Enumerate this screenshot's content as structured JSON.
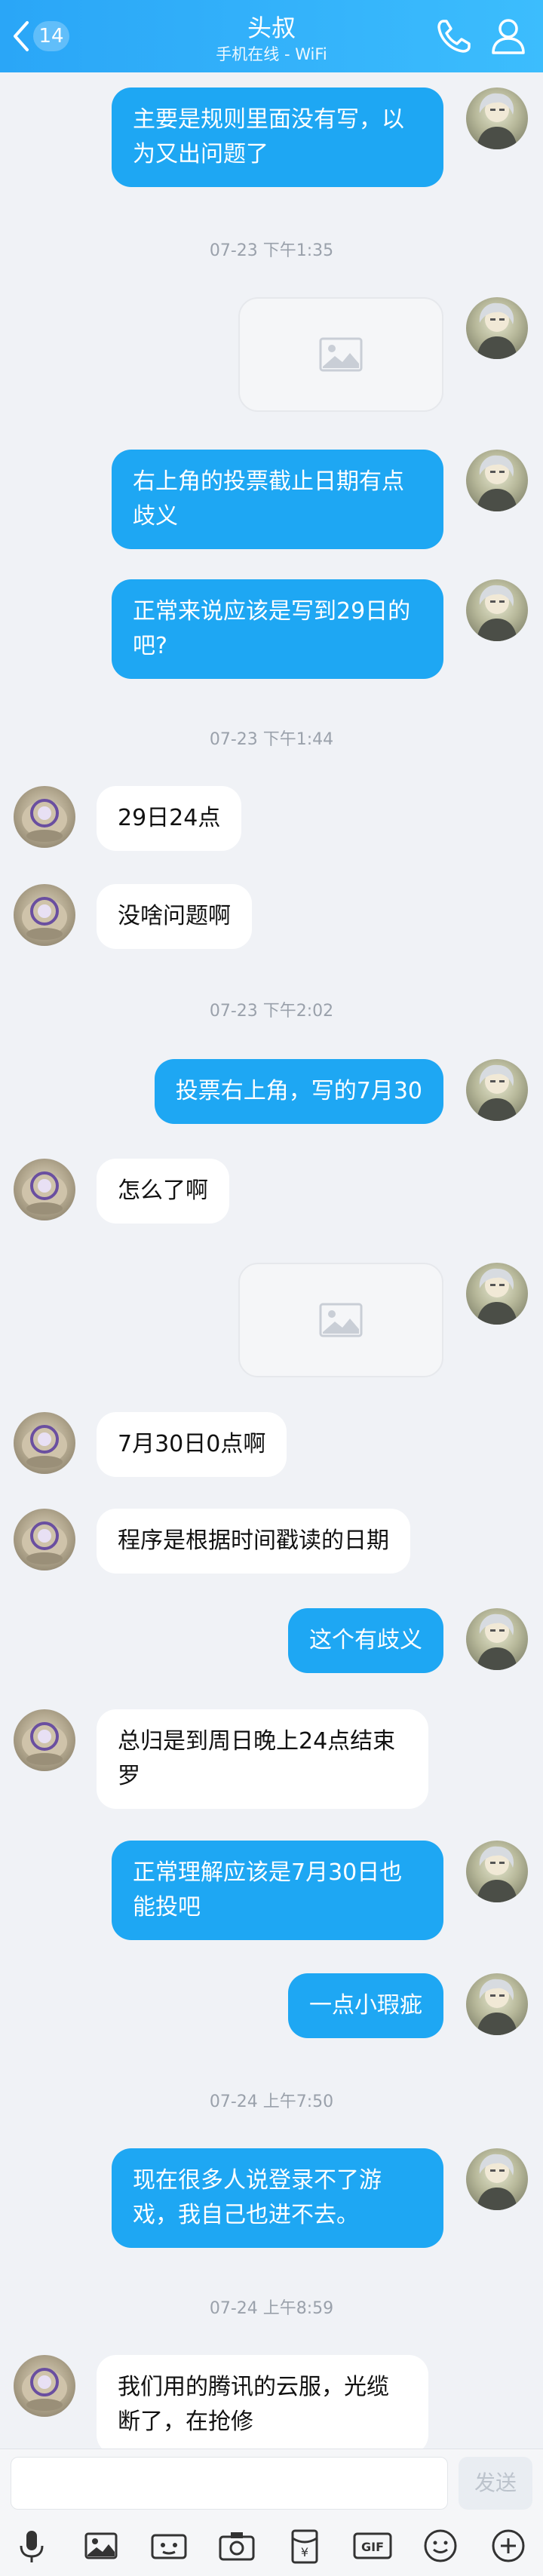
{
  "header": {
    "back_count": "14",
    "title": "头叔",
    "status": "手机在线 - WiFi"
  },
  "timestamps": [
    "07-23 下午1:35",
    "07-23 下午1:44",
    "07-23 下午2:02",
    "07-24 上午7:50",
    "07-24 上午8:59"
  ],
  "messages": [
    {
      "side": "me",
      "text": "主要是规则里面没有写，以为又出问题了"
    },
    {
      "side": "me",
      "type": "image"
    },
    {
      "side": "me",
      "text": "右上角的投票截止日期有点歧义"
    },
    {
      "side": "me",
      "text": "正常来说应该是写到29日的吧?"
    },
    {
      "side": "other",
      "text": "29日24点"
    },
    {
      "side": "other",
      "text": "没啥问题啊"
    },
    {
      "side": "me",
      "text": "投票右上角，写的7月30"
    },
    {
      "side": "other",
      "text": "怎么了啊"
    },
    {
      "side": "me",
      "type": "image"
    },
    {
      "side": "other",
      "text": "7月30日0点啊"
    },
    {
      "side": "other",
      "text": "程序是根据时间戳读的日期"
    },
    {
      "side": "me",
      "text": "这个有歧义"
    },
    {
      "side": "other",
      "text": "总归是到周日晚上24点结束罗"
    },
    {
      "side": "me",
      "text": "正常理解应该是7月30日也能投吧"
    },
    {
      "side": "me",
      "text": "一点小瑕疵"
    },
    {
      "side": "me",
      "text": "现在很多人说登录不了游戏，我自己也进不去。"
    },
    {
      "side": "other",
      "text": "我们用的腾讯的云服，光缆断了，在抢修"
    }
  ],
  "input": {
    "send_label": "发送",
    "value": ""
  },
  "toolbar": [
    "mic-icon",
    "picture-icon",
    "video-icon",
    "camera-icon",
    "red-packet-icon",
    "gif-icon",
    "emoji-icon",
    "plus-icon"
  ]
}
